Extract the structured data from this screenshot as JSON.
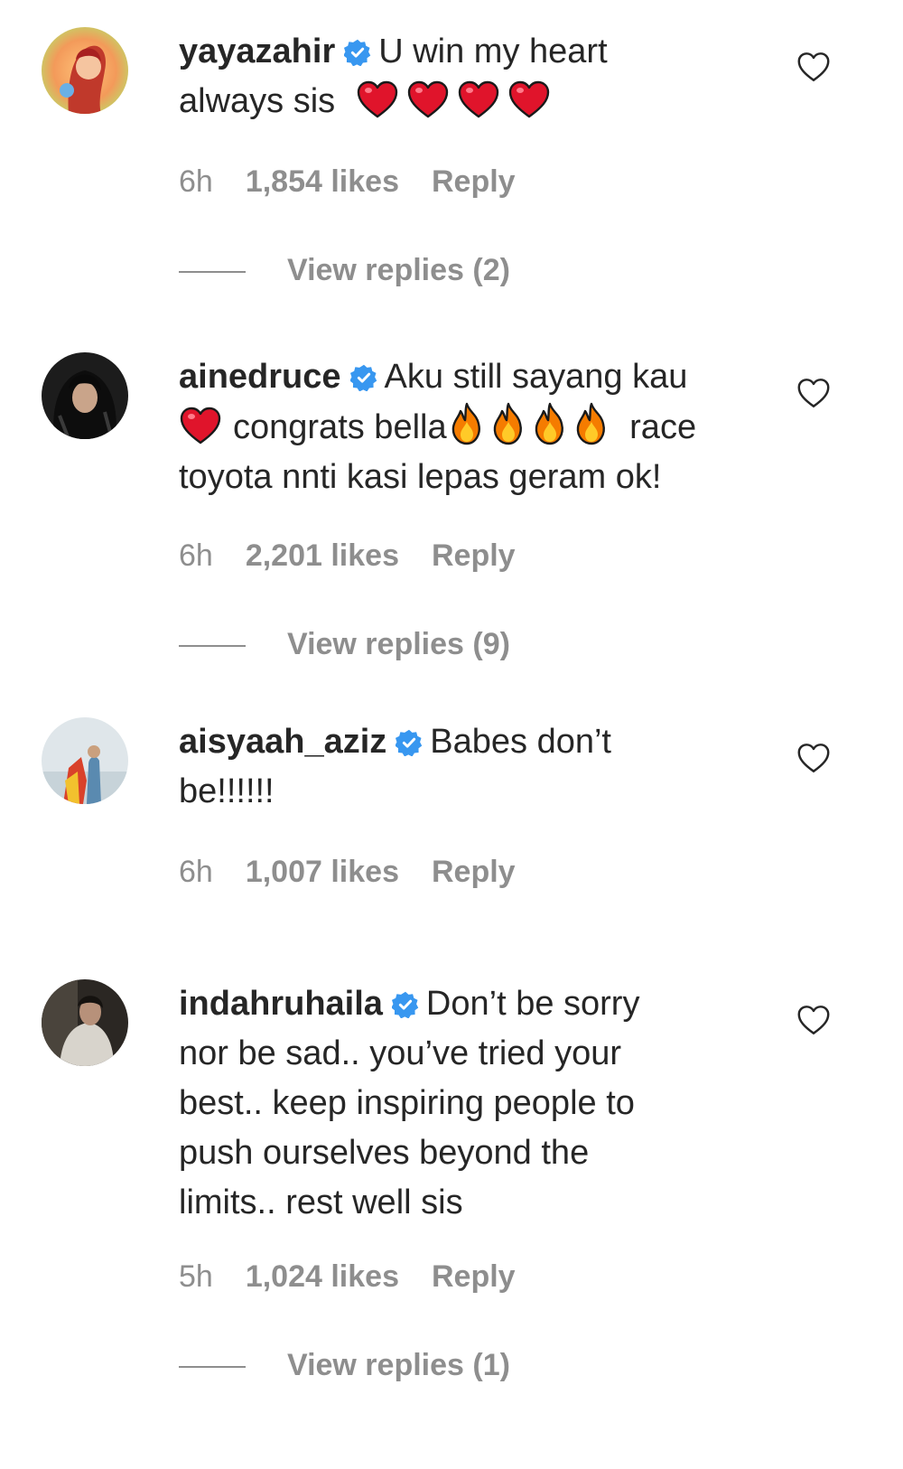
{
  "comments": [
    {
      "username": "yayazahir",
      "text_before": "U win my heart",
      "text_line2": "always sis",
      "emoji": [
        "red-heart",
        "red-heart",
        "red-heart",
        "red-heart"
      ],
      "time": "6h",
      "likes": "1,854 likes",
      "reply": "Reply",
      "view_replies": "View replies (2)"
    },
    {
      "username": "ainedruce",
      "text_before": "Aku still sayang kau",
      "text_line2_after_heart": "congrats bella",
      "text_line2_end": "race",
      "text_line3": "toyota nnti kasi lepas geram ok!",
      "emoji": [
        "red-heart",
        "fire",
        "fire",
        "fire",
        "fire"
      ],
      "time": "6h",
      "likes": "2,201 likes",
      "reply": "Reply",
      "view_replies": "View replies (9)"
    },
    {
      "username": "aisyaah_aziz",
      "text_before": "Babes don’t",
      "text_line2": "be!!!!!!",
      "time": "6h",
      "likes": "1,007 likes",
      "reply": "Reply"
    },
    {
      "username": "indahruhaila",
      "text_before": "Don’t be sorry",
      "text_line2": "nor be sad.. you’ve tried your",
      "text_line3": "best.. keep inspiring people to",
      "text_line4": "push ourselves beyond the",
      "text_line5": "limits.. rest well sis",
      "time": "5h",
      "likes": "1,024 likes",
      "reply": "Reply",
      "view_replies": "View replies (1)"
    }
  ],
  "colors": {
    "text": "#262626",
    "muted": "#8e8e8e",
    "verified": "#3897f0",
    "heart_emoji": "#e0142b",
    "fire_outer": "#f57c00",
    "fire_inner": "#ffca28"
  },
  "icons": {
    "verified": "verified-badge-icon",
    "like": "heart-outline-icon",
    "emoji_heart": "red-heart-emoji",
    "emoji_fire": "fire-emoji"
  }
}
